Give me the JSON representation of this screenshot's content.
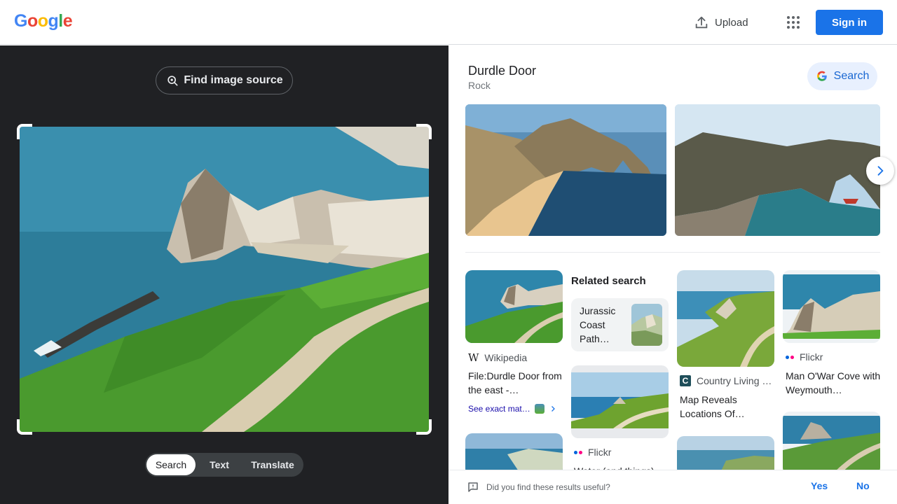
{
  "header": {
    "logo_letters": [
      "G",
      "o",
      "o",
      "g",
      "l",
      "e"
    ],
    "logo_colors": [
      "#4285f4",
      "#ea4335",
      "#fbbc05",
      "#4285f4",
      "#34a853",
      "#ea4335"
    ],
    "upload_label": "Upload",
    "signin_label": "Sign in",
    "icons": [
      "upload-icon",
      "apps-grid-icon"
    ]
  },
  "left": {
    "find_source_label": "Find image source",
    "modes": [
      "Search",
      "Text",
      "Translate"
    ],
    "active_mode": "Search"
  },
  "right": {
    "entity_title": "Durdle Door",
    "entity_subtitle": "Rock",
    "search_chip_label": "Search",
    "cards": [
      {
        "source": "Wikipedia",
        "title": "File:Durdle Door from the east -…",
        "exact_match": "See exact mat…"
      },
      {
        "source": "Country Living …",
        "title": "Map Reveals Locations Of…"
      },
      {
        "source": "Flickr",
        "title": "Man O'War Cove with Weymouth…"
      },
      {
        "source": "Flickr",
        "title": "Water (and things)…"
      }
    ],
    "related": {
      "heading": "Related search",
      "item": "Jurassic Coast Path…"
    }
  },
  "feedback": {
    "question": "Did you find these results useful?",
    "yes": "Yes",
    "no": "No"
  },
  "colors": {
    "accent": "#1a73e8",
    "left_panel_bg": "#202124",
    "chip_bg": "#e8f0fe"
  }
}
